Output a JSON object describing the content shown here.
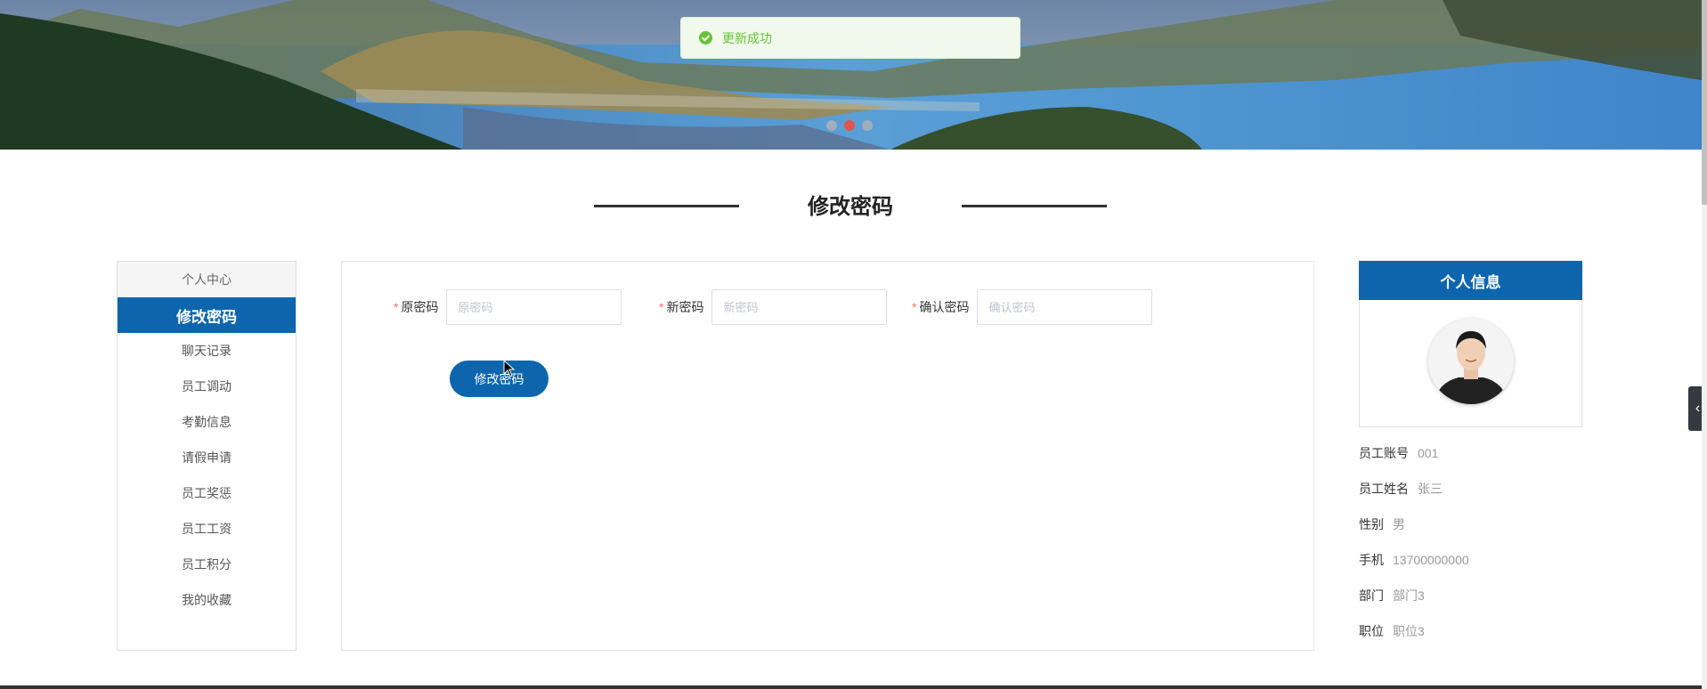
{
  "toast": {
    "message": "更新成功"
  },
  "page_title": "修改密码",
  "menu": {
    "header": "个人中心",
    "items": [
      "修改密码",
      "聊天记录",
      "员工调动",
      "考勤信息",
      "请假申请",
      "员工奖惩",
      "员工工资",
      "员工积分",
      "我的收藏"
    ]
  },
  "form": {
    "old_password": {
      "label": "原密码",
      "placeholder": "原密码",
      "value": ""
    },
    "new_password": {
      "label": "新密码",
      "placeholder": "新密码",
      "value": ""
    },
    "confirm_password": {
      "label": "确认密码",
      "placeholder": "确认密码",
      "value": ""
    },
    "required_mark": "*",
    "submit_label": "修改密码"
  },
  "profile": {
    "header": "个人信息",
    "fields": [
      {
        "label": "员工账号",
        "value": "001"
      },
      {
        "label": "员工姓名",
        "value": "张三"
      },
      {
        "label": "性别",
        "value": "男"
      },
      {
        "label": "手机",
        "value": "13700000000"
      },
      {
        "label": "部门",
        "value": "部门3"
      },
      {
        "label": "职位",
        "value": "职位3"
      }
    ]
  },
  "carousel": {
    "slides": 3,
    "active_slide": 2
  },
  "side_tab_icon": "chevron-left-icon",
  "colors": {
    "primary": "#0d66ad",
    "success": "#67c23a",
    "required": "#f56c6c",
    "dot_active": "#ee4c3c"
  }
}
